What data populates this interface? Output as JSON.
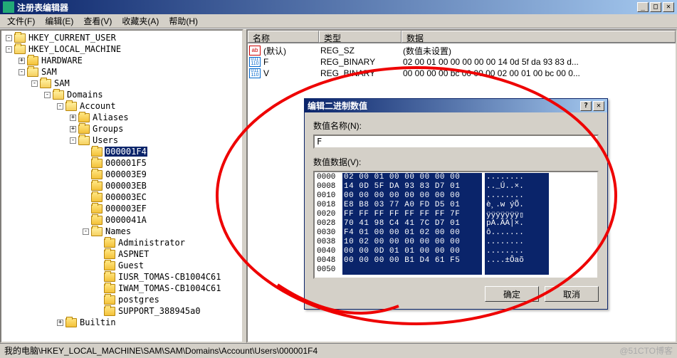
{
  "window": {
    "title": "注册表编辑器",
    "min": "_",
    "max": "□",
    "close": "✕"
  },
  "menu": {
    "file": "文件(F)",
    "edit": "编辑(E)",
    "view": "查看(V)",
    "fav": "收藏夹(A)",
    "help": "帮助(H)"
  },
  "tree": [
    {
      "depth": 0,
      "exp": "-",
      "icon": "open",
      "label": "HKEY_CURRENT_USER"
    },
    {
      "depth": 0,
      "exp": "-",
      "icon": "open",
      "label": "HKEY_LOCAL_MACHINE"
    },
    {
      "depth": 1,
      "exp": "+",
      "icon": "closed",
      "label": "HARDWARE"
    },
    {
      "depth": 1,
      "exp": "-",
      "icon": "open",
      "label": "SAM"
    },
    {
      "depth": 2,
      "exp": "-",
      "icon": "open",
      "label": "SAM"
    },
    {
      "depth": 3,
      "exp": "-",
      "icon": "open",
      "label": "Domains"
    },
    {
      "depth": 4,
      "exp": "-",
      "icon": "open",
      "label": "Account"
    },
    {
      "depth": 5,
      "exp": "+",
      "icon": "closed",
      "label": "Aliases"
    },
    {
      "depth": 5,
      "exp": "+",
      "icon": "closed",
      "label": "Groups"
    },
    {
      "depth": 5,
      "exp": "-",
      "icon": "open",
      "label": "Users"
    },
    {
      "depth": 6,
      "exp": "",
      "icon": "closed",
      "label": "000001F4",
      "sel": true
    },
    {
      "depth": 6,
      "exp": "",
      "icon": "closed",
      "label": "000001F5"
    },
    {
      "depth": 6,
      "exp": "",
      "icon": "closed",
      "label": "000003E9"
    },
    {
      "depth": 6,
      "exp": "",
      "icon": "closed",
      "label": "000003EB"
    },
    {
      "depth": 6,
      "exp": "",
      "icon": "closed",
      "label": "000003EC"
    },
    {
      "depth": 6,
      "exp": "",
      "icon": "closed",
      "label": "000003EF"
    },
    {
      "depth": 6,
      "exp": "",
      "icon": "closed",
      "label": "0000041A"
    },
    {
      "depth": 6,
      "exp": "-",
      "icon": "open",
      "label": "Names"
    },
    {
      "depth": 7,
      "exp": "",
      "icon": "closed",
      "label": "Administrator"
    },
    {
      "depth": 7,
      "exp": "",
      "icon": "closed",
      "label": "ASPNET"
    },
    {
      "depth": 7,
      "exp": "",
      "icon": "closed",
      "label": "Guest"
    },
    {
      "depth": 7,
      "exp": "",
      "icon": "closed",
      "label": "IUSR_TOMAS-CB1004C61"
    },
    {
      "depth": 7,
      "exp": "",
      "icon": "closed",
      "label": "IWAM_TOMAS-CB1004C61"
    },
    {
      "depth": 7,
      "exp": "",
      "icon": "closed",
      "label": "postgres"
    },
    {
      "depth": 7,
      "exp": "",
      "icon": "closed",
      "label": "SUPPORT_388945a0"
    },
    {
      "depth": 4,
      "exp": "+",
      "icon": "closed",
      "label": "Builtin"
    }
  ],
  "list": {
    "headers": {
      "name": "名称",
      "type": "类型",
      "data": "数据"
    },
    "rows": [
      {
        "icon": "ab",
        "name": "(默认)",
        "type": "REG_SZ",
        "data": "(数值未设置)"
      },
      {
        "icon": "bin",
        "name": "F",
        "type": "REG_BINARY",
        "data": "02 00 01 00 00 00 00 00 14 0d 5f da 93 83 d..."
      },
      {
        "icon": "bin",
        "name": "V",
        "type": "REG_BINARY",
        "data": "00 00 00 00 bc 00 00 00 02 00 01 00 bc 00 0..."
      }
    ]
  },
  "dialog": {
    "title": "编辑二进制数值",
    "help": "?",
    "close": "✕",
    "name_label": "数值名称(N):",
    "name_value": "F",
    "data_label": "数值数据(V):",
    "hex": [
      {
        "off": "0000",
        "h": "02 00 01 00 00 00 00 00",
        "a": "........"
      },
      {
        "off": "0008",
        "h": "14 0D 5F DA 93 83 D7 01",
        "a": ".._Ú..×."
      },
      {
        "off": "0010",
        "h": "00 00 00 00 00 00 00 00",
        "a": "........"
      },
      {
        "off": "0018",
        "h": "E8 B8 03 77 A0 FD D5 01",
        "a": "è¸.w ýÕ."
      },
      {
        "off": "0020",
        "h": "FF FF FF FF FF FF FF 7F",
        "a": "ÿÿÿÿÿÿÿ▯"
      },
      {
        "off": "0028",
        "h": "70 41 98 C4 41 7C D7 01",
        "a": "pA.ÄA|×."
      },
      {
        "off": "0030",
        "h": "F4 01 00 00 01 02 00 00",
        "a": "ô......."
      },
      {
        "off": "0038",
        "h": "10 02 00 00 00 00 00 00",
        "a": "........"
      },
      {
        "off": "0040",
        "h": "00 00 0D 01 01 00 00 00",
        "a": "........"
      },
      {
        "off": "0048",
        "h": "00 00 00 00 B1 D4 61 F5",
        "a": "....±Ôaõ"
      },
      {
        "off": "0050",
        "h": "",
        "a": ""
      }
    ],
    "ok": "确定",
    "cancel": "取消"
  },
  "status": {
    "path": "我的电脑\\HKEY_LOCAL_MACHINE\\SAM\\SAM\\Domains\\Account\\Users\\000001F4",
    "watermark": "@51CTO博客"
  }
}
